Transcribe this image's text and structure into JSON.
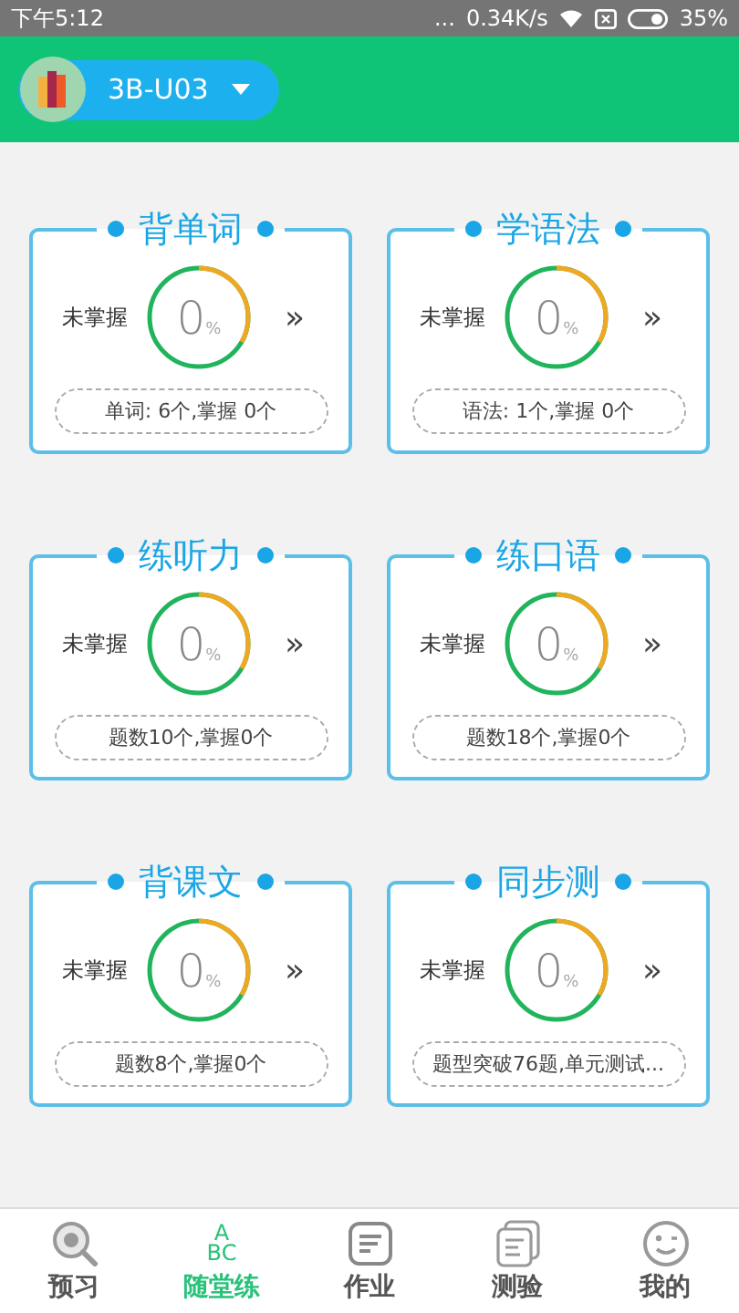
{
  "status_bar": {
    "time": "下午5:12",
    "dots": "...",
    "speed": "0.34K/s",
    "battery": "35%"
  },
  "header": {
    "course": "3B-U03"
  },
  "cards": [
    {
      "title": "背单词",
      "label": "未掌握",
      "percent": "0",
      "unit": "%",
      "more": "»",
      "summary": "单词: 6个,掌握 0个"
    },
    {
      "title": "学语法",
      "label": "未掌握",
      "percent": "0",
      "unit": "%",
      "more": "»",
      "summary": "语法: 1个,掌握 0个"
    },
    {
      "title": "练听力",
      "label": "未掌握",
      "percent": "0",
      "unit": "%",
      "more": "»",
      "summary": "题数10个,掌握0个"
    },
    {
      "title": "练口语",
      "label": "未掌握",
      "percent": "0",
      "unit": "%",
      "more": "»",
      "summary": "题数18个,掌握0个"
    },
    {
      "title": "背课文",
      "label": "未掌握",
      "percent": "0",
      "unit": "%",
      "more": "»",
      "summary": "题数8个,掌握0个"
    },
    {
      "title": "同步测",
      "label": "未掌握",
      "percent": "0",
      "unit": "%",
      "more": "»",
      "summary": "题型突破76题,单元测试..."
    }
  ],
  "tabs": [
    {
      "label": "预习",
      "kind": "search",
      "selected": false
    },
    {
      "label": "随堂练",
      "kind": "letters",
      "icon_lines": [
        "A",
        "BC"
      ],
      "selected": true
    },
    {
      "label": "作业",
      "kind": "document",
      "selected": false
    },
    {
      "label": "测验",
      "kind": "papers",
      "selected": false
    },
    {
      "label": "我的",
      "kind": "face",
      "selected": false
    }
  ]
}
